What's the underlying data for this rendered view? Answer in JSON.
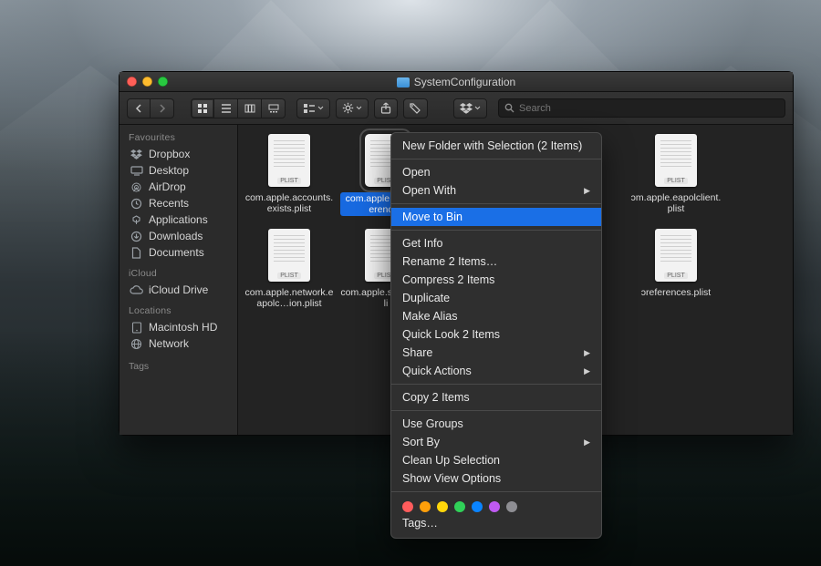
{
  "window": {
    "title": "SystemConfiguration",
    "search_placeholder": "Search"
  },
  "toolbar": {
    "icons": {
      "back": "chevron-left-icon",
      "forward": "chevron-right-icon",
      "view_icon": "grid-icon",
      "view_list": "list-icon",
      "view_columns": "columns-icon",
      "view_gallery": "gallery-icon",
      "group": "group-icon",
      "action": "gear-icon",
      "share": "share-icon",
      "tags": "tag-icon",
      "dropbox": "dropbox-icon",
      "search": "magnifier-icon"
    }
  },
  "sidebar": {
    "groups": [
      {
        "label": "Favourites",
        "items": [
          {
            "icon": "dropbox-icon",
            "label": "Dropbox"
          },
          {
            "icon": "desktop-icon",
            "label": "Desktop"
          },
          {
            "icon": "airdrop-icon",
            "label": "AirDrop"
          },
          {
            "icon": "clock-icon",
            "label": "Recents"
          },
          {
            "icon": "apps-icon",
            "label": "Applications"
          },
          {
            "icon": "downloads-icon",
            "label": "Downloads"
          },
          {
            "icon": "documents-icon",
            "label": "Documents"
          }
        ]
      },
      {
        "label": "iCloud",
        "items": [
          {
            "icon": "cloud-icon",
            "label": "iCloud Drive"
          }
        ]
      },
      {
        "label": "Locations",
        "items": [
          {
            "icon": "disk-icon",
            "label": "Macintosh HD"
          },
          {
            "icon": "globe-icon",
            "label": "Network"
          }
        ]
      }
    ],
    "tags_label": "Tags"
  },
  "files": [
    {
      "name": "com.apple.accounts.exists.plist",
      "type": "PLIST",
      "selected": false
    },
    {
      "name": "com.apple.a….preferences",
      "type": "PLIST",
      "selected": true
    },
    {
      "name": "",
      "type": "PLIST",
      "selected": false,
      "hidden_behind_menu": true
    },
    {
      "name": "",
      "type": "PLIST",
      "selected": false,
      "hidden_behind_menu": true
    },
    {
      "name": "ɔm.apple.eapolclient.plist",
      "type": "PLIST",
      "selected": false
    },
    {
      "name": "com.apple.network.eapolc…ion.plist",
      "type": "PLIST",
      "selected": false
    },
    {
      "name": "com.apple.s…erver.pli",
      "type": "PLIST",
      "selected": false
    },
    {
      "name": "",
      "type": "PLIST",
      "selected": false,
      "hidden_behind_menu": true
    },
    {
      "name": "",
      "type": "PLIST",
      "selected": false,
      "hidden_behind_menu": true
    },
    {
      "name": "ɔreferences.plist",
      "type": "PLIST",
      "selected": false
    }
  ],
  "context_menu": {
    "items": [
      {
        "label": "New Folder with Selection (2 Items)"
      },
      {
        "sep": true
      },
      {
        "label": "Open"
      },
      {
        "label": "Open With",
        "submenu": true
      },
      {
        "sep": true
      },
      {
        "label": "Move to Bin",
        "highlighted": true
      },
      {
        "sep": true
      },
      {
        "label": "Get Info"
      },
      {
        "label": "Rename 2 Items…"
      },
      {
        "label": "Compress 2 Items"
      },
      {
        "label": "Duplicate"
      },
      {
        "label": "Make Alias"
      },
      {
        "label": "Quick Look 2 Items"
      },
      {
        "label": "Share",
        "submenu": true
      },
      {
        "label": "Quick Actions",
        "submenu": true
      },
      {
        "sep": true
      },
      {
        "label": "Copy 2 Items"
      },
      {
        "sep": true
      },
      {
        "label": "Use Groups"
      },
      {
        "label": "Sort By",
        "submenu": true
      },
      {
        "label": "Clean Up Selection"
      },
      {
        "label": "Show View Options"
      },
      {
        "sep": true
      },
      {
        "tagdots": true
      },
      {
        "label": "Tags…"
      }
    ]
  }
}
